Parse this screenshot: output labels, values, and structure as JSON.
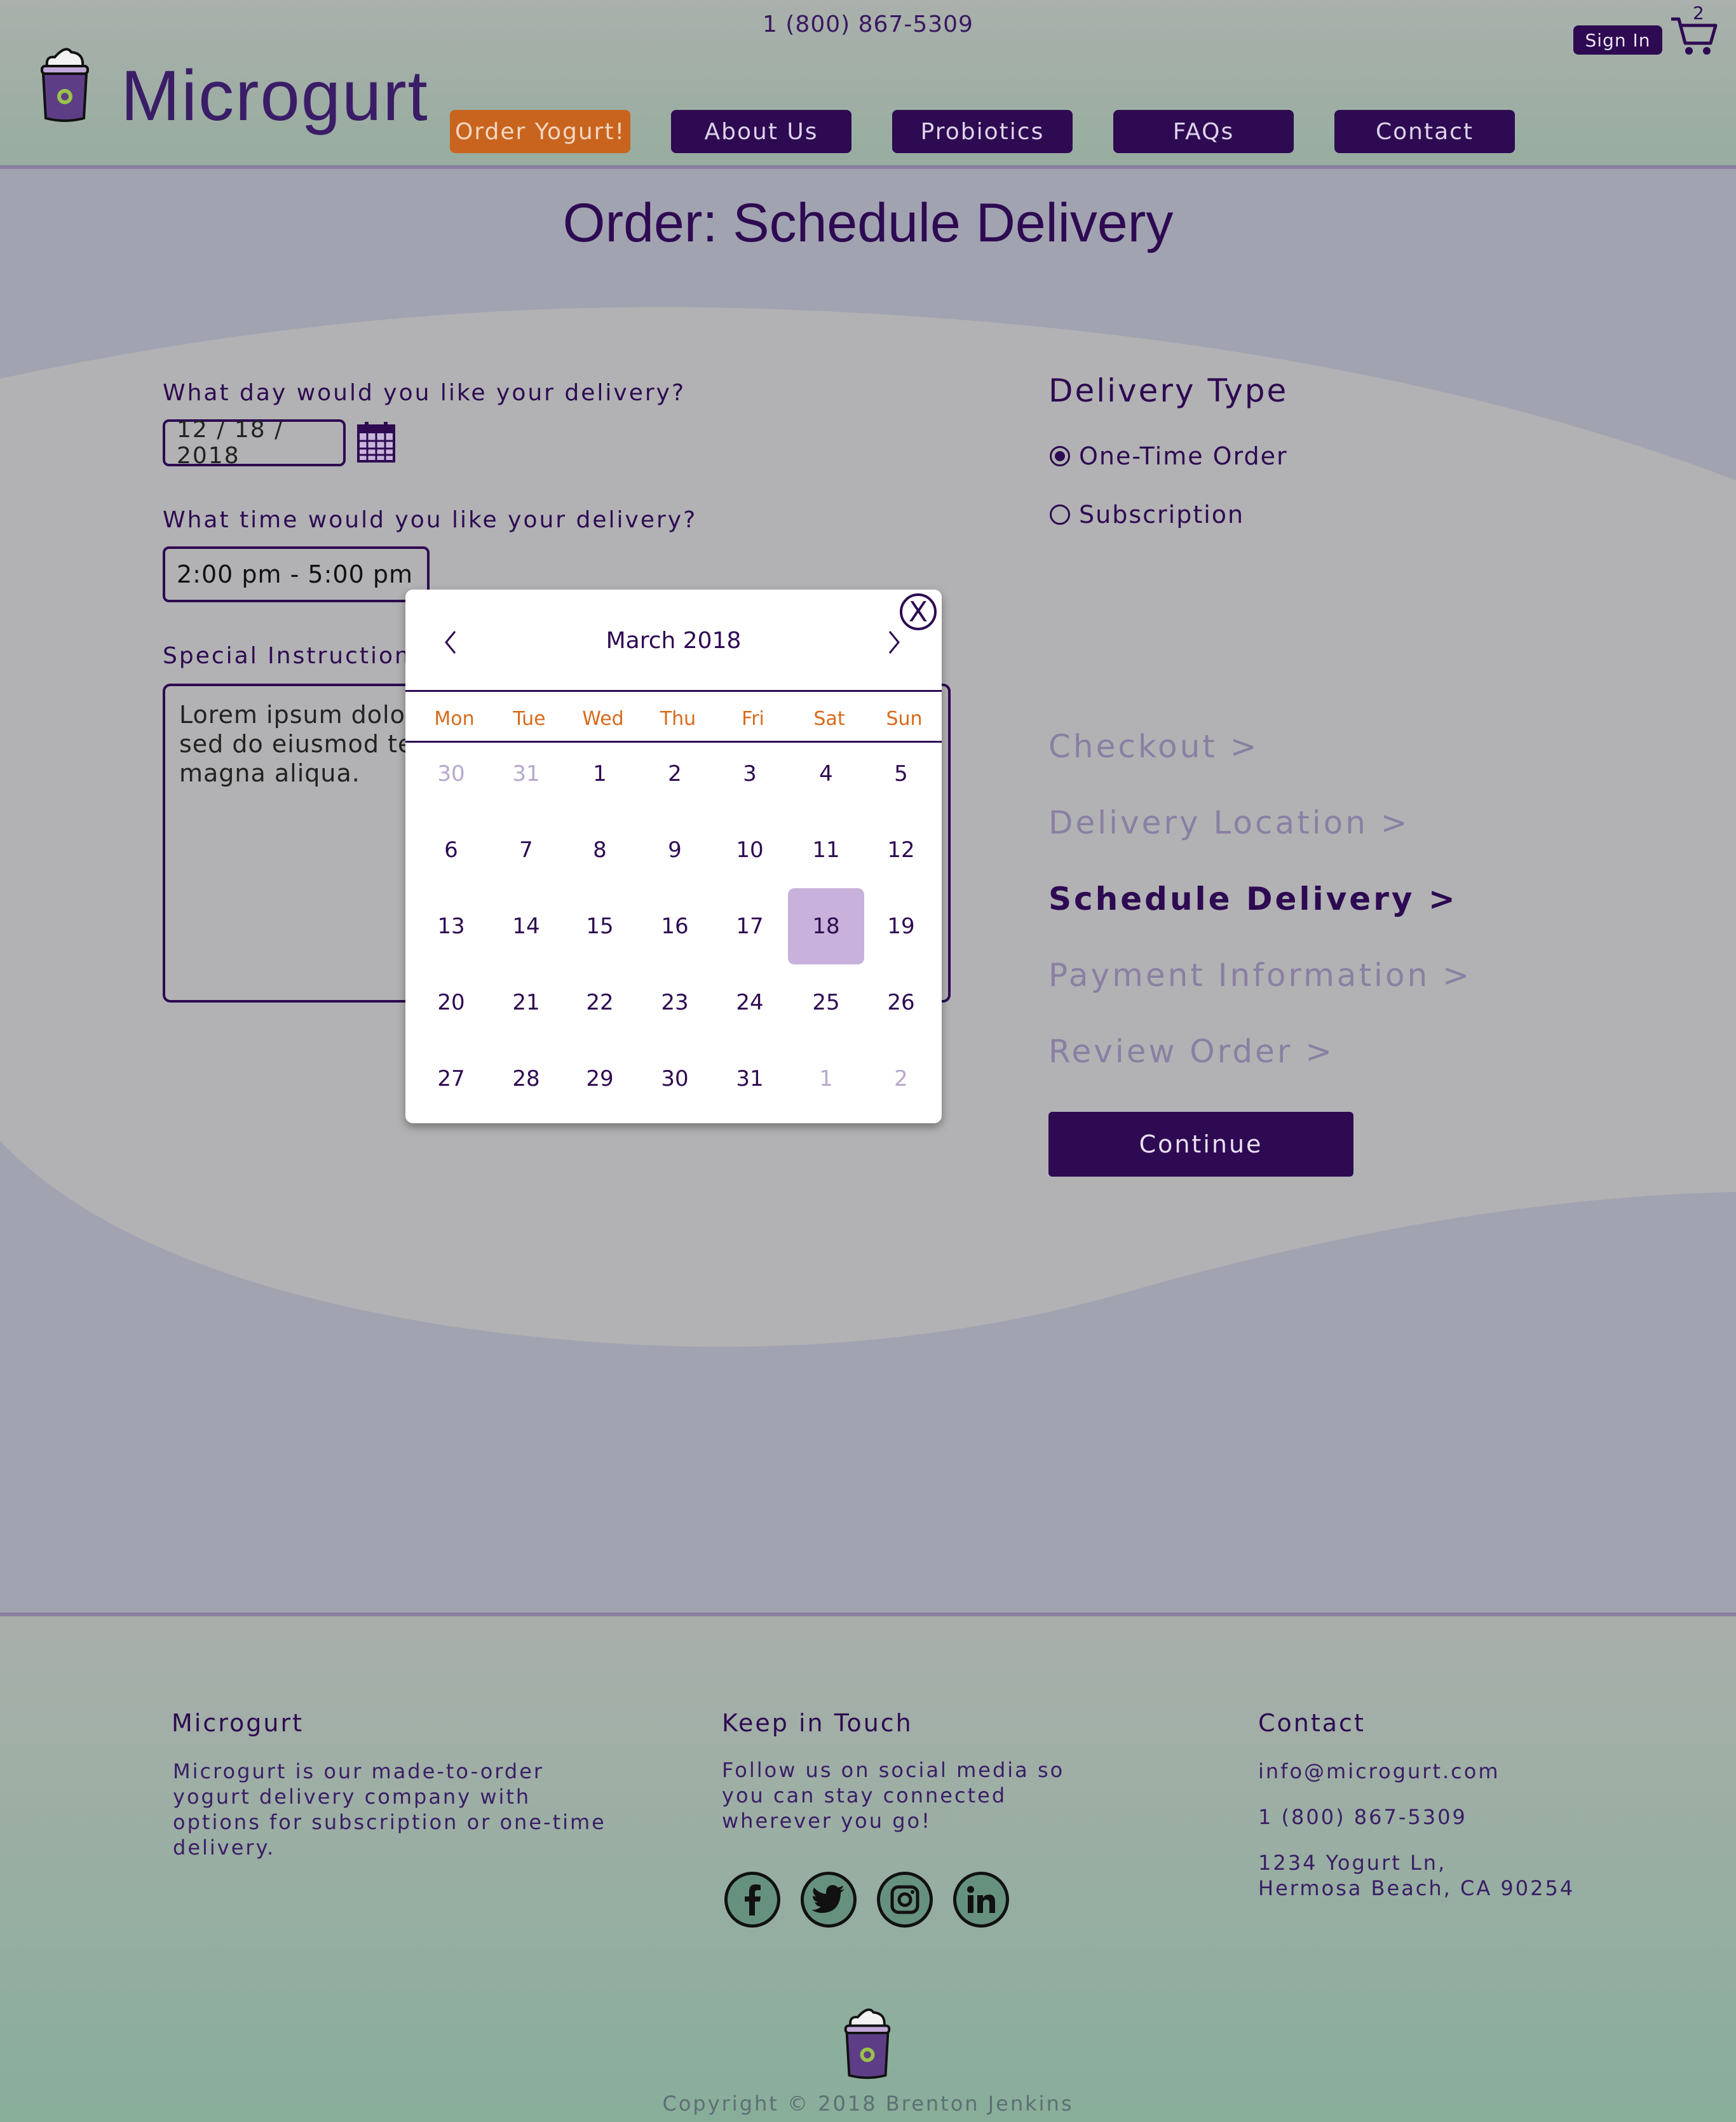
{
  "header": {
    "phone": "1 (800) 867-5309",
    "brand": "Microgurt",
    "sign_in": "Sign In",
    "cart_count": "2",
    "nav": {
      "order": "Order Yogurt!",
      "about": "About Us",
      "probiotics": "Probiotics",
      "faqs": "FAQs",
      "contact": "Contact"
    }
  },
  "page_title": "Order: Schedule Delivery",
  "form": {
    "date_label": "What day would you like your delivery?",
    "date_value": "12 / 18 / 2018",
    "time_label": "What time would you like your delivery?",
    "time_value": "2:00 pm - 5:00 pm",
    "instructions_label": "Special Instructions",
    "instructions_value": "Lorem ipsum dolor sit amet, consectetur adipiscing elit, sed do eiusmod tempor incididunt ut labore et dolore magna aliqua."
  },
  "delivery_type": {
    "heading": "Delivery Type",
    "options": [
      "One-Time Order",
      "Subscription"
    ],
    "selected": "One-Time Order"
  },
  "steps": {
    "checkout": "Checkout >",
    "location": "Delivery Location >",
    "schedule": "Schedule Delivery >",
    "payment": "Payment Information >",
    "review": "Review Order >",
    "active": "Schedule Delivery >"
  },
  "continue_label": "Continue",
  "calendar": {
    "month_label": "March 2018",
    "prev": "<",
    "next": ">",
    "close": "X",
    "weekdays": [
      "Mon",
      "Tue",
      "Wed",
      "Thu",
      "Fri",
      "Sat",
      "Sun"
    ],
    "weeks": [
      [
        "30",
        "31",
        "1",
        "2",
        "3",
        "4",
        "5"
      ],
      [
        "6",
        "7",
        "8",
        "9",
        "10",
        "11",
        "12"
      ],
      [
        "13",
        "14",
        "15",
        "16",
        "17",
        "18",
        "19"
      ],
      [
        "20",
        "21",
        "22",
        "23",
        "24",
        "25",
        "26"
      ],
      [
        "27",
        "28",
        "29",
        "30",
        "31",
        "1",
        "2"
      ]
    ],
    "selected_day": "18",
    "colors": {
      "accent": "#2e0a52",
      "weekday": "#d86a1c",
      "selected": "#c8b2db",
      "muted": "#b8a8cc"
    }
  },
  "footer": {
    "brand_head": "Microgurt",
    "brand_text": "Microgurt is our made-to-order yogurt delivery company with options for subscription or one-time delivery.",
    "keep_head": "Keep in Touch",
    "keep_text": "Follow us on social media so you can stay connected wherever you go!",
    "social": [
      "facebook-icon",
      "twitter-icon",
      "instagram-icon",
      "linkedin-icon"
    ],
    "contact_head": "Contact",
    "email": "info@microgurt.com",
    "phone": "1 (800) 867-5309",
    "address_line1": "1234 Yogurt Ln,",
    "address_line2": "Hermosa Beach, CA 90254",
    "copyright": "Copyright © 2018 Brenton Jenkins"
  },
  "colors": {
    "brand": "#2e0a52",
    "order_button": "#c9641f",
    "header_bg": "#aab0ac",
    "main_bg": "#a2a3b1"
  }
}
